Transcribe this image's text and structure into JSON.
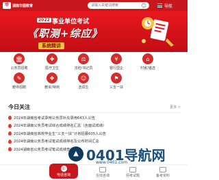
{
  "header": {
    "logo_text": "湖南华图教育",
    "search_placeholder": "请输入关键词搜索",
    "nav_label": "导航"
  },
  "banner": {
    "year": "2022",
    "top_text": "事业单位考试",
    "main_text": "《职测+综应》",
    "sub_text": "系统精讲"
  },
  "grid": [
    {
      "label": "公务员招聘",
      "icon": "building-icon",
      "glyph": "🏛"
    },
    {
      "label": "医疗卫生",
      "icon": "medical-icon",
      "glyph": "✚"
    },
    {
      "label": "法检/书记员",
      "icon": "scale-icon",
      "glyph": "⚖"
    },
    {
      "label": "银行国企",
      "icon": "bank-icon",
      "glyph": "¥"
    },
    {
      "label": "村官/遴选",
      "icon": "village-icon",
      "glyph": "⌂"
    },
    {
      "label": "教师招聘",
      "icon": "teacher-icon",
      "glyph": "✎"
    },
    {
      "label": "教资/特岗",
      "icon": "certificate-icon",
      "glyph": "❖"
    },
    {
      "label": "选调生",
      "icon": "person-icon",
      "glyph": "☺"
    },
    {
      "label": "三支一扶",
      "icon": "flag-icon",
      "glyph": "⚑"
    }
  ],
  "today": {
    "title": "今日关注",
    "more": "更多 >",
    "items": [
      "2024年湖南省考试录用公务员补充录用643人公告",
      "2024年湖南公务员考试综合成绩排名汇总（含面试成绩）",
      "2024年湖南省高校毕业生“三支一扶”计划招募605人公告",
      "2024年湖南公务员考试笔试成绩排名及公布时间汇总",
      "2024湖南省公务员考试笔试成绩查询入口"
    ]
  },
  "bottom_nav": {
    "center_label": "电话咨询",
    "center_icon_glyph": "☏",
    "items": [
      {
        "label": "在线咨询"
      },
      {
        "label": "招考试题"
      },
      {
        "label": "备考资料"
      }
    ]
  },
  "watermark": {
    "text": "0401导航网",
    "glyph": "▲",
    "sub": "www.0401.com"
  },
  "colors": {
    "brand_red": "#c8161d",
    "banner_gold": "#f5c33b"
  }
}
